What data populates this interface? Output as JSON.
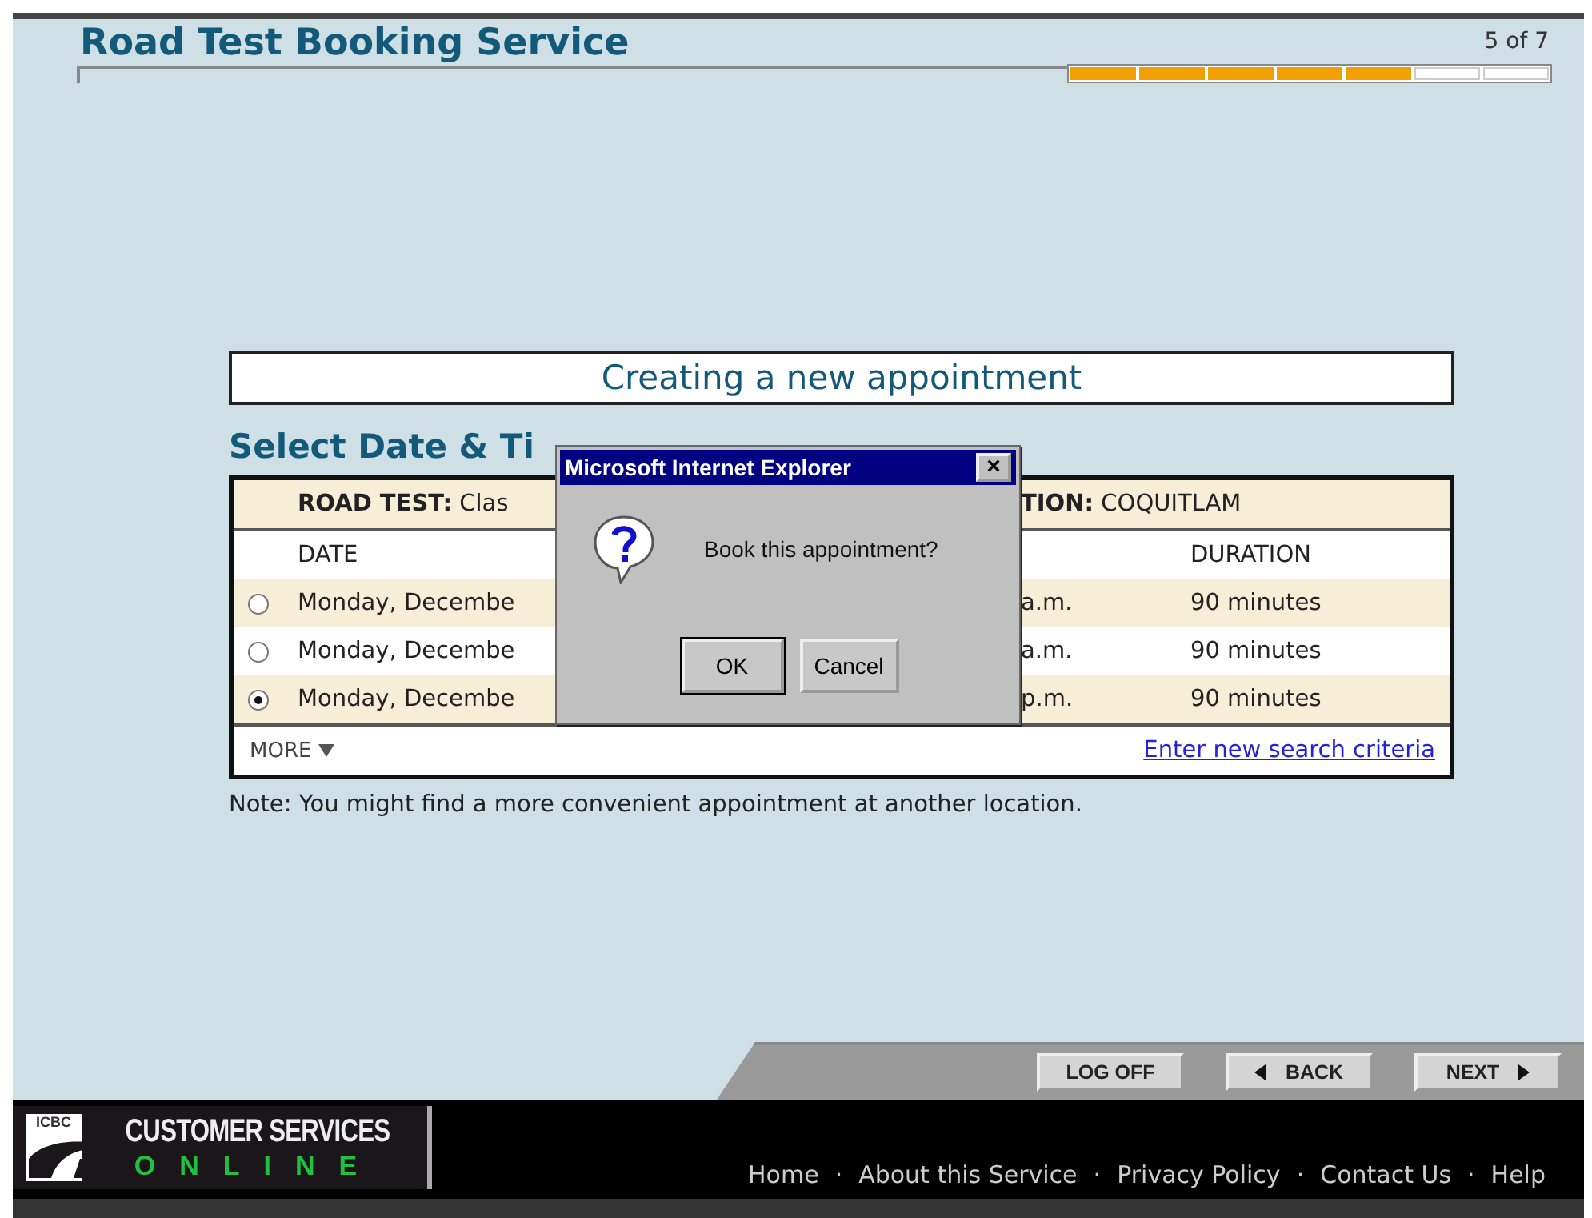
{
  "header": {
    "title": "Road Test Booking Service",
    "step": "5 of 7",
    "steps": [
      {
        "done": true
      },
      {
        "done": true
      },
      {
        "done": true
      },
      {
        "done": true
      },
      {
        "done": true
      },
      {
        "done": false
      },
      {
        "done": false
      }
    ]
  },
  "banner": "Creating a new appointment",
  "section_title": "Select Date & Ti",
  "table": {
    "info_left": "**ROAD TEST:** Clas",
    "info_right": "**TION:** COQUITLAM",
    "columns": [
      "DATE",
      "DURATION"
    ],
    "rows": [
      {
        "date": "Monday, Decembe",
        "time": "a.m.",
        "duration": "90 minutes",
        "selected": false
      },
      {
        "date": "Monday, Decembe",
        "time": "a.m.",
        "duration": "90 minutes",
        "selected": false
      },
      {
        "date": "Monday, Decembe",
        "time": "p.m.",
        "duration": "90 minutes",
        "selected": true
      }
    ],
    "more": "MORE",
    "link": "Enter new search criteria"
  },
  "note": "Note: You might find a more convenient appointment at another location.",
  "dialog": {
    "title": "Microsoft Internet Explorer",
    "close": "×",
    "message": "Book this appointment?",
    "buttons": [
      {
        "label": "OK",
        "default": true
      },
      {
        "label": "Cancel",
        "default": false
      }
    ]
  },
  "nav_buttons": [
    {
      "label": "LOG OFF",
      "kind": "plain"
    },
    {
      "label": "BACK",
      "kind": "back"
    },
    {
      "label": "NEXT",
      "kind": "next"
    }
  ],
  "logo": {
    "badge": "ICBC",
    "line1": "CUSTOMER SERVICES",
    "line2": "ONLINE"
  },
  "footer_links": [
    "Home",
    "About this Service",
    "Privacy Policy",
    "Contact Us",
    "Help"
  ],
  "footer_separator": "·"
}
